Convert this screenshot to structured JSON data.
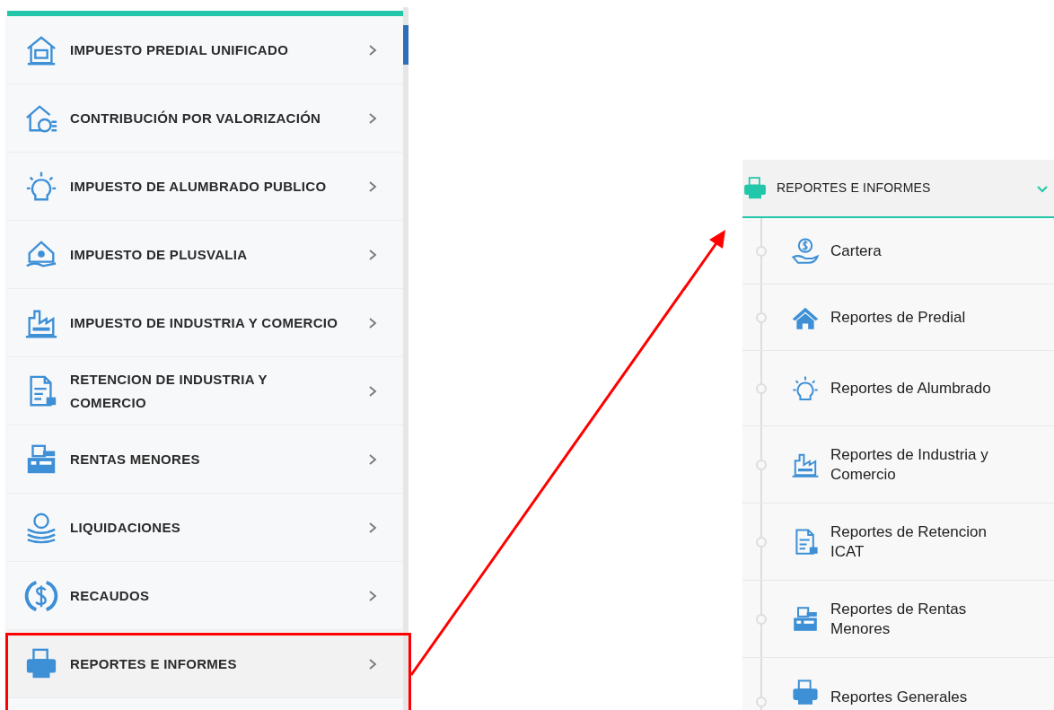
{
  "main_menu": {
    "items": [
      {
        "label": "IMPUESTO PREDIAL UNIFICADO",
        "selected": false,
        "highlighted": false
      },
      {
        "label": "CONTRIBUCIÓN POR VALORIZACIÓN",
        "selected": false,
        "highlighted": false
      },
      {
        "label": "IMPUESTO DE ALUMBRADO PUBLICO",
        "selected": false,
        "highlighted": false
      },
      {
        "label": "IMPUESTO DE PLUSVALIA",
        "selected": false,
        "highlighted": false
      },
      {
        "label": "IMPUESTO DE INDUSTRIA Y COMERCIO",
        "selected": false,
        "highlighted": false
      },
      {
        "label": "RETENCION DE INDUSTRIA Y COMERCIO",
        "selected": false,
        "highlighted": false
      },
      {
        "label": "RENTAS MENORES",
        "selected": false,
        "highlighted": false
      },
      {
        "label": "LIQUIDACIONES",
        "selected": false,
        "highlighted": false
      },
      {
        "label": "RECAUDOS",
        "selected": false,
        "highlighted": false
      },
      {
        "label": "REPORTES E INFORMES",
        "selected": true,
        "highlighted": true
      }
    ]
  },
  "submenu": {
    "title": "REPORTES E INFORMES",
    "expanded": true,
    "items": [
      {
        "label": "Cartera"
      },
      {
        "label": "Reportes de Predial"
      },
      {
        "label": "Reportes de Alumbrado"
      },
      {
        "label": "Reportes de Industria y Comercio"
      },
      {
        "label": "Reportes de Retencion ICAT"
      },
      {
        "label": "Reportes de Rentas Menores"
      },
      {
        "label": "Reportes Generales"
      }
    ]
  }
}
